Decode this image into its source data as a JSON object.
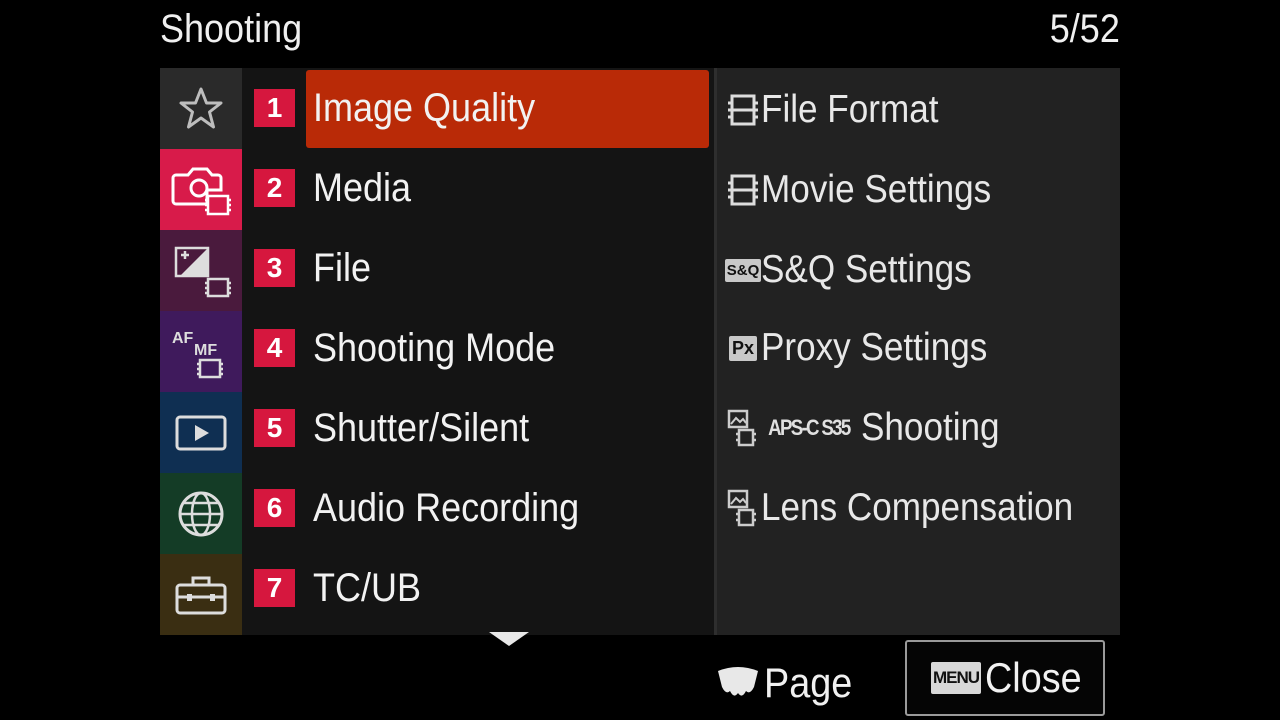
{
  "header": {
    "title": "Shooting",
    "page_counter": "5/52"
  },
  "tabs": [
    {
      "name": "my-menu",
      "icon": "star-icon",
      "bg": "#2a2a2a",
      "selected": false
    },
    {
      "name": "shooting",
      "icon": "camera-movie-icon",
      "bg": "#d81b4a",
      "selected": true
    },
    {
      "name": "exposure-color",
      "icon": "exposure-movie-icon",
      "bg": "#4a1a3d",
      "selected": false
    },
    {
      "name": "focus",
      "icon": "af-mf-movie-icon",
      "bg": "#3f1a5c",
      "selected": false
    },
    {
      "name": "playback",
      "icon": "playback-icon",
      "bg": "#0f2f52",
      "selected": false
    },
    {
      "name": "network",
      "icon": "globe-icon",
      "bg": "#143c26",
      "selected": false
    },
    {
      "name": "setup",
      "icon": "toolbox-icon",
      "bg": "#3a2e12",
      "selected": false
    }
  ],
  "menu": {
    "items": [
      {
        "num": "1",
        "label": "Image Quality",
        "selected": true
      },
      {
        "num": "2",
        "label": "Media",
        "selected": false
      },
      {
        "num": "3",
        "label": "File",
        "selected": false
      },
      {
        "num": "4",
        "label": "Shooting Mode",
        "selected": false
      },
      {
        "num": "5",
        "label": "Shutter/Silent",
        "selected": false
      },
      {
        "num": "6",
        "label": "Audio Recording",
        "selected": false
      },
      {
        "num": "7",
        "label": "TC/UB",
        "selected": false
      }
    ]
  },
  "submenu": {
    "items": [
      {
        "icon": "film-icon",
        "label": "File Format"
      },
      {
        "icon": "film-icon",
        "label": "Movie Settings"
      },
      {
        "icon": "sq-badge-icon",
        "badge": "S&Q",
        "label": "S&Q Settings"
      },
      {
        "icon": "px-badge-icon",
        "badge": "Px",
        "label": "Proxy Settings"
      },
      {
        "icon": "photo-movie-icon",
        "prefix": "APS-C S35",
        "label": "Shooting"
      },
      {
        "icon": "photo-movie-icon",
        "label": "Lens Compensation"
      }
    ]
  },
  "footer": {
    "page_label": "Page",
    "menu_key": "MENU",
    "close_label": "Close"
  },
  "colors": {
    "accent_number": "#d6173e",
    "highlight": "#b92a07"
  }
}
